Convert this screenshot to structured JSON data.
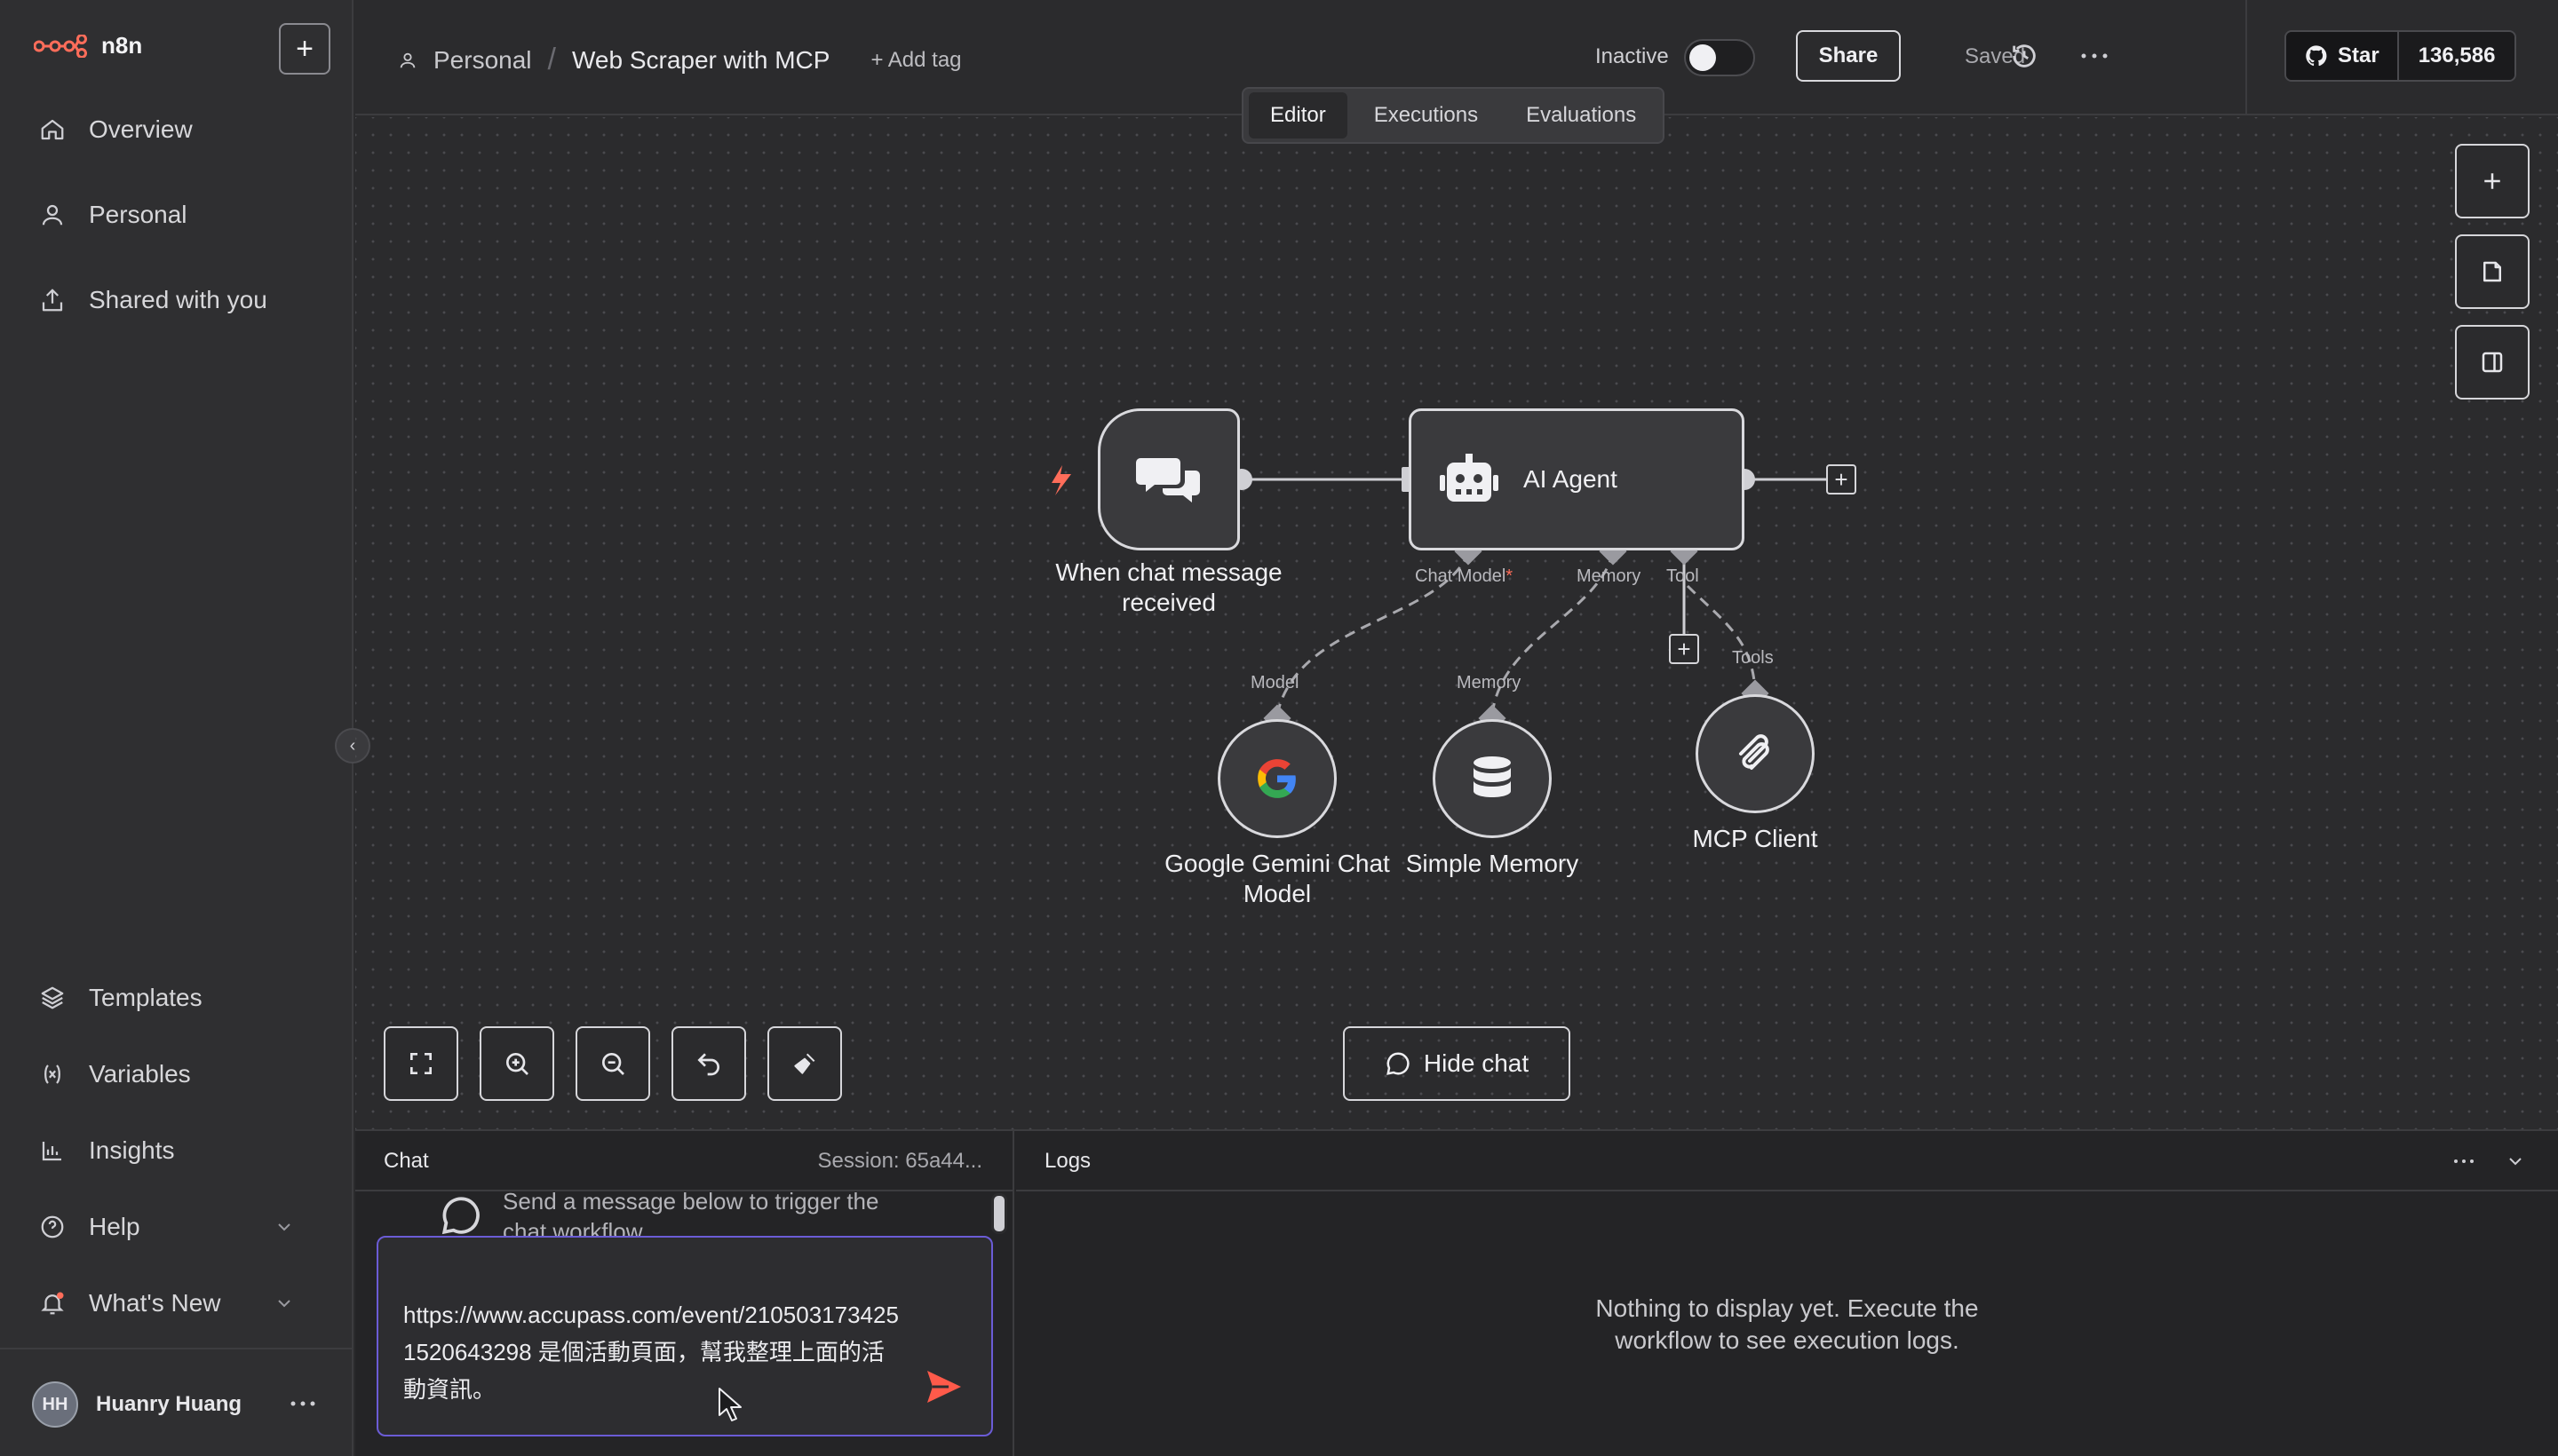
{
  "brand": {
    "name": "n8n"
  },
  "sidebar": {
    "items": [
      {
        "label": "Overview"
      },
      {
        "label": "Personal"
      },
      {
        "label": "Shared with you"
      },
      {
        "label": "Templates"
      },
      {
        "label": "Variables"
      },
      {
        "label": "Insights"
      },
      {
        "label": "Help"
      },
      {
        "label": "What's New"
      }
    ],
    "user": {
      "initials": "HH",
      "name": "Huanry Huang"
    }
  },
  "header": {
    "project": "Personal",
    "workflow": "Web Scraper with MCP",
    "add_tag": "+ Add tag",
    "status": "Inactive",
    "share": "Share",
    "saved": "Saved",
    "github_star": "Star",
    "github_count": "136,586"
  },
  "tabs": [
    {
      "label": "Editor"
    },
    {
      "label": "Executions"
    },
    {
      "label": "Evaluations"
    }
  ],
  "nodes": {
    "trigger": {
      "label": "When chat message received"
    },
    "agent": {
      "title": "AI Agent",
      "port_chat_model": "Chat Model",
      "required_mark": "*",
      "port_memory": "Memory",
      "port_tool": "Tool"
    },
    "gemini": {
      "label": "Google Gemini Chat Model",
      "port": "Model"
    },
    "memory": {
      "label": "Simple Memory",
      "port": "Memory"
    },
    "mcp": {
      "label": "MCP Client",
      "port": "Tools"
    }
  },
  "canvas": {
    "hide_chat": "Hide chat"
  },
  "chat": {
    "title": "Chat",
    "session": "Session: 65a44...",
    "hint": "Send a message below to trigger the chat workflow",
    "input_value": "https://www.accupass.com/event/2105031734251520643298 是個活動頁面，幫我整理上面的活動資訊。"
  },
  "logs": {
    "title": "Logs",
    "empty": "Nothing to display yet. Execute the workflow to see execution logs."
  },
  "colors": {
    "accent": "#ff6d5a",
    "send": "#ff5a4a",
    "focus": "#6b5cd6"
  }
}
